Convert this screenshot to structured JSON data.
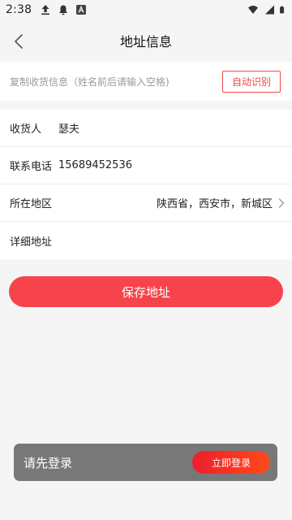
{
  "status_bar": {
    "time": "2:38",
    "left_icons": [
      "upload-icon",
      "notification-bell-icon",
      "app-a-icon"
    ],
    "right_icons": [
      "wifi-icon",
      "signal-icon",
      "battery-icon"
    ]
  },
  "header": {
    "title": "地址信息",
    "back_icon": "chevron-left-icon"
  },
  "paste": {
    "hint": "复制收货信息（姓名前后请输入空格)",
    "auto_button": "自动识别"
  },
  "form": {
    "receiver_label": "收货人",
    "receiver_value": "瑟夫",
    "phone_label": "联系电话",
    "phone_value": "15689452536",
    "region_label": "所在地区",
    "region_value": "陕西省，西安市，新城区",
    "detail_label": "详细地址",
    "detail_value": ""
  },
  "save_button": "保存地址",
  "login_prompt": {
    "text": "请先登录",
    "button": "立即登录"
  },
  "colors": {
    "accent": "#f7434b",
    "background": "#f5f5f5",
    "toast_bg": "#787878"
  }
}
